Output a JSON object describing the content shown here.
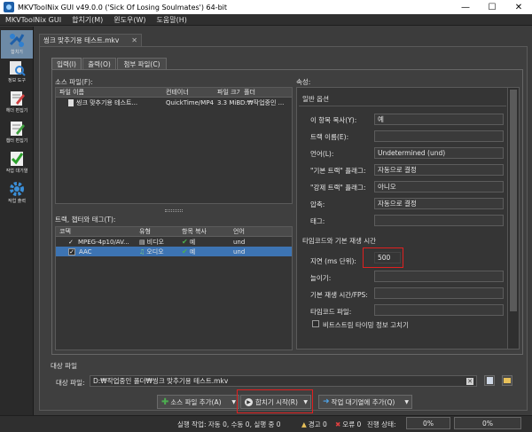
{
  "window": {
    "title": "MKVToolNix GUI v49.0.0 ('Sick Of Losing Soulmates') 64-bit",
    "minimize": "—",
    "maximize": "☐",
    "close": "✕"
  },
  "menu": [
    "MKVToolNix GUI",
    "합치기(M)",
    "윈도우(W)",
    "도움말(H)"
  ],
  "sidebar": [
    {
      "label": "합치기"
    },
    {
      "label": "정보 도구"
    },
    {
      "label": "헤더 편집기"
    },
    {
      "label": "챕터 편집기"
    },
    {
      "label": "작업 대기열"
    },
    {
      "label": "작업 출력"
    }
  ],
  "file_tab": {
    "label": "씽크 맞추기용 테스트.mkv",
    "close": "✕"
  },
  "subtabs": [
    "입력(I)",
    "출력(O)",
    "첨부 파일(C)"
  ],
  "source_files": {
    "section_label": "소스 파일(F):",
    "columns": [
      "파일 이름",
      "컨테이너",
      "파일 크기",
      "폴더"
    ],
    "rows": [
      {
        "name": "씽크 맞추기용 테스트...",
        "container": "QuickTime/MP4",
        "size": "3.3 MiB",
        "folder": "D:₩작업중인 ..."
      }
    ]
  },
  "tracks": {
    "section_label": "트랙, 챕터와 태그(T):",
    "columns": [
      "코덱",
      "유형",
      "항목 복사",
      "언어"
    ],
    "rows": [
      {
        "codec": "MPEG-4p10/AV...",
        "type": "비디오",
        "copy": "예",
        "lang": "und",
        "selected": false
      },
      {
        "codec": "AAC",
        "type": "오디오",
        "copy": "예",
        "lang": "und",
        "selected": true
      }
    ]
  },
  "properties": {
    "section_label": "속성:",
    "general_header": "일반 옵션",
    "fields": [
      {
        "label": "이 항목 복사(Y):",
        "value": "예"
      },
      {
        "label": "트랙 이름(E):",
        "value": ""
      },
      {
        "label": "언어(L):",
        "value": "Undetermined (und)"
      },
      {
        "label": "\"기본 트랙\" 플래그:",
        "value": "자동으로 결정"
      },
      {
        "label": "\"강제 트랙\" 플래그:",
        "value": "아니오"
      },
      {
        "label": "압축:",
        "value": "자동으로 결정"
      },
      {
        "label": "태그:",
        "value": ""
      }
    ],
    "timing_header": "타임코드와 기본 재생 시간",
    "delay_label": "지연 (ms 단위):",
    "delay_value": "500",
    "stretch_label": "늘이기:",
    "duration_label": "기본 재생 시간/FPS:",
    "timecode_file_label": "타임코드 파일:",
    "fix_bitstream_label": "비트스트림 타이밍 정보 고치기"
  },
  "output": {
    "section_label": "대상 파일",
    "field_label": "대상 파일:",
    "value": "D:₩작업중인 폴더₩씽크 맞추기용 테스트.mkv"
  },
  "buttons": {
    "add_source": "소스 파일 추가(A)",
    "start_mux": "합치기 시작(R)",
    "add_queue": "작업 대기열에 추가(Q)"
  },
  "status": {
    "jobs": "실행 작업: 자동 0, 수동 0, 실행 중 0",
    "warnings": "경고 0",
    "errors": "오류 0",
    "progress_label": "진행 상태:",
    "progress1": "0%",
    "progress2": "0%"
  },
  "colors": {
    "selection": "#3d74b3",
    "highlight": "#e02020",
    "sidebar_active": "#6d8aa6"
  }
}
